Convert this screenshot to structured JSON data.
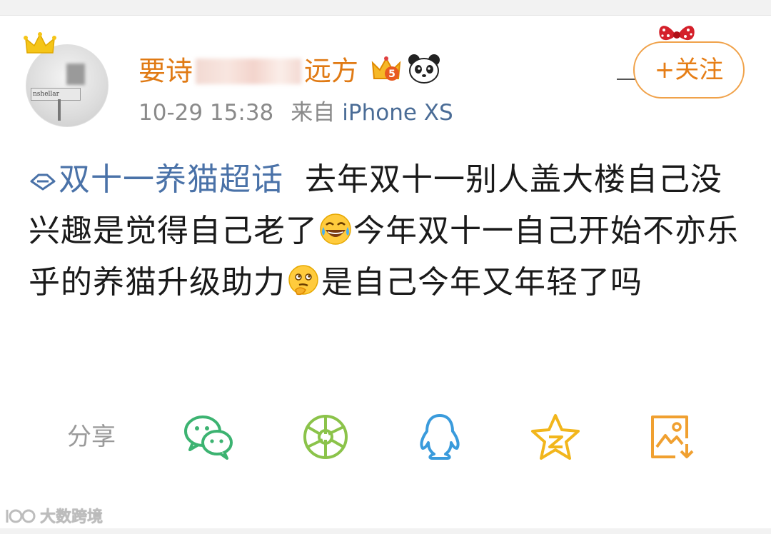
{
  "header": {
    "username_prefix": "要诗",
    "username_suffix": "远方",
    "timestamp": "10-29 15:38",
    "source_label": "来自",
    "device": "iPhone XS",
    "follow_button": "+关注",
    "avatar_sign_text": "nshellar",
    "vip_badge_number": "5"
  },
  "post": {
    "topic": "双十一养猫超话",
    "segment_1": "去年双十一别人盖大楼自己没兴趣是觉得自己老了",
    "segment_2": "今年双十一自己开始不亦乐乎的养猫升级助力",
    "segment_3": "是自己今年又年轻了吗",
    "emoji_1": "laugh-cry-emoji",
    "emoji_2": "thinking-emoji"
  },
  "share": {
    "label": "分享",
    "targets": [
      "wechat",
      "moments",
      "qq",
      "qzone",
      "save-image"
    ]
  },
  "watermark": {
    "text": "大数跨境"
  },
  "colors": {
    "username": "#e07a14",
    "topic": "#4a72a8",
    "device": "#4a6c96",
    "follow": "#e67e16",
    "wechat": "#3cb371",
    "moments": "#8bc34a",
    "qq": "#3a9bdc",
    "qzone": "#f2b61c",
    "save": "#f0a030"
  }
}
